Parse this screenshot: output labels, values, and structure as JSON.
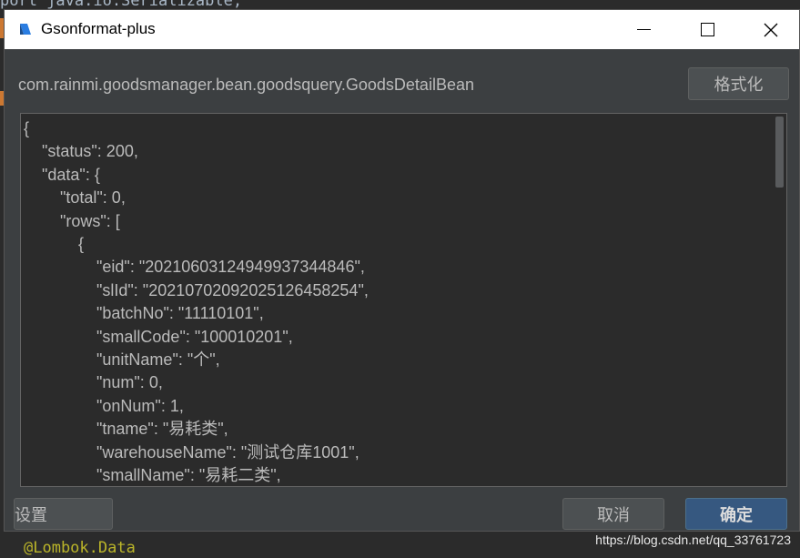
{
  "background": {
    "code_top": "port java.io.Serializable;",
    "code_bottom": "@Lombok.Data",
    "watermark": "https://blog.csdn.net/qq_33761723"
  },
  "dialog": {
    "title": "Gsonformat-plus",
    "class_name": "com.rainmi.goodsmanager.bean.goodsquery.GoodsDetailBean",
    "format_button": "格式化",
    "settings_button": "设置",
    "cancel_button": "取消",
    "ok_button": "确定",
    "json_text": "{\n    \"status\": 200,\n    \"data\": {\n        \"total\": 0,\n        \"rows\": [\n            {\n                \"eid\": \"2021060312494993734484​6\",\n                \"slId\": \"2021070209202512645825​4\",\n                \"batchNo\": \"11110101\",\n                \"smallCode\": \"100010201\",\n                \"unitName\": \"个\",\n                \"num\": 0,\n                \"onNum\": 1,\n                \"tname\": \"易耗类\",\n                \"warehouseName\": \"测试仓库1001\",\n                \"smallName\": \"易耗二类\","
  },
  "colors": {
    "dialog_bg": "#3c3f41",
    "editor_bg": "#2b2b2b",
    "text": "#bbbbbb",
    "ok_button_bg": "#365880"
  },
  "icons": {
    "app": "intellij-plugin-icon",
    "minimize": "minimize-icon",
    "maximize": "maximize-icon",
    "close": "close-icon"
  }
}
